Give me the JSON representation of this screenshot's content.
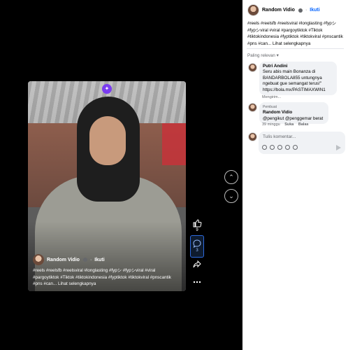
{
  "post": {
    "author": "Random Vidio",
    "separator": "·",
    "follow_label": "Ikuti",
    "caption": "#reels #reelsfb #reelsviral #longlasting #fypシ #fypシviral #viral #pargoytiktok #Tiktok #tiktokindonesia #fyptiktok #tiktokviral #pnscantik #pns #can... Lihat selengkapnya"
  },
  "video_overlay": {
    "author": "Random Vidio",
    "separator": "·",
    "follow_label": "Ikuti",
    "caption": "#reels #reelsfb #reelsviral #longlasting #fypシ #fypシviral #viral #pargoytiktok #Tiktok #tiktokindonesia #fyptiktok #tiktokviral #pnscantik #pns #can... Lihat selengkapnya"
  },
  "actions": {
    "like_count": "9",
    "comment_count": "3"
  },
  "comments_section": {
    "sort_label": "Paling relevan ▾",
    "comments": [
      {
        "author": "Putri Andini",
        "text": "Seru abis main Bonanza di BANDARBOLA855 untungnya ngebuat gue semangat terus!\" https://bola.mx/PASTIMAXWIN1",
        "meta": "Mengirim..."
      },
      {
        "badge": "Pembuat",
        "author": "Random Vidio",
        "text": "@pengikut @penggemar berat",
        "time": "39 minggu",
        "like_label": "Suka",
        "reply_label": "Balas"
      }
    ],
    "write_placeholder": "Tulis komentar..."
  },
  "icons": [
    "sparkle-icon",
    "like-icon",
    "comment-icon",
    "share-icon",
    "more-icon",
    "chevron-up-icon",
    "chevron-down-icon",
    "send-icon",
    "verified-icon"
  ]
}
